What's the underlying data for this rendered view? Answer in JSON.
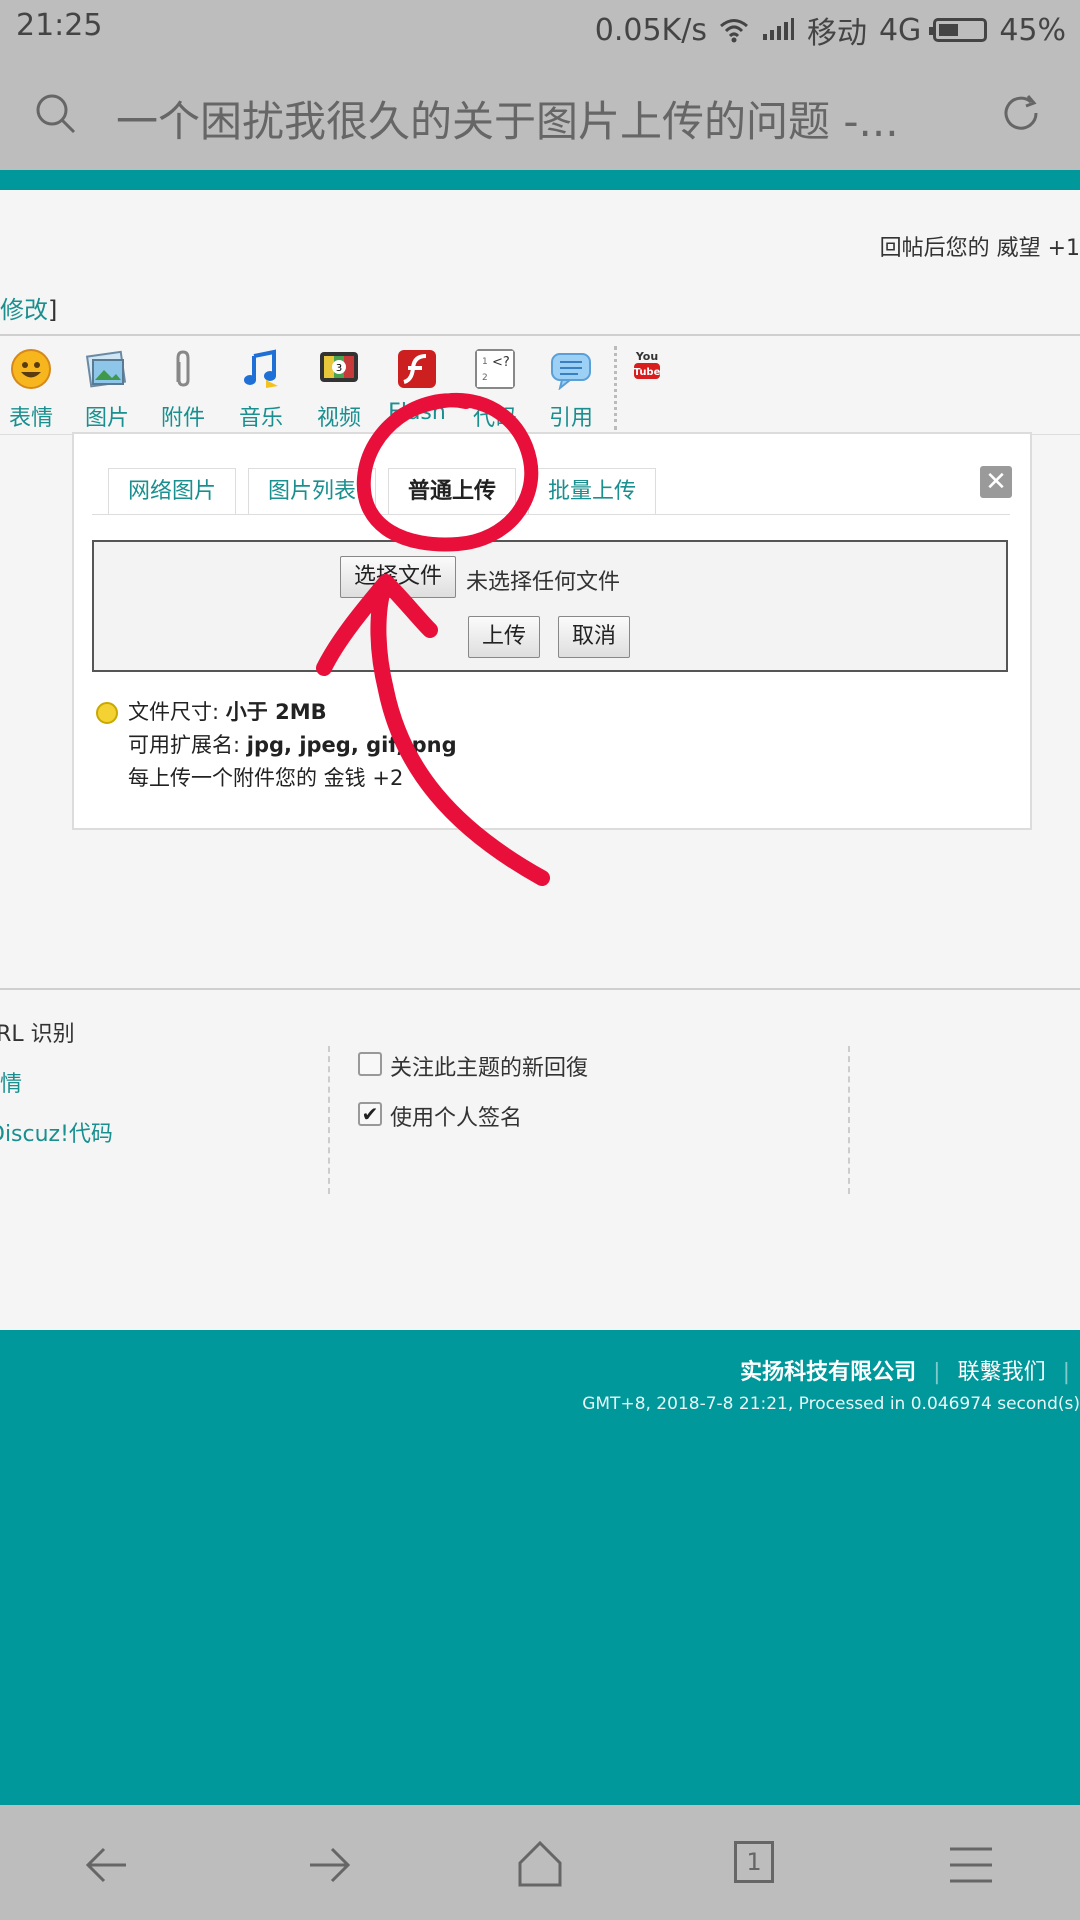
{
  "status_bar": {
    "time": "21:25",
    "speed": "0.05K/s",
    "carrier": "移动",
    "network": "4G",
    "battery": "45%",
    "battery_level": 0.45
  },
  "address_bar": {
    "title": "一个困扰我很久的关于图片上传的问题 -..."
  },
  "page": {
    "reply_prestige": "回帖后您的 威望 +1",
    "edit_fragment_bracket": "]",
    "edit_fragment_link": "修改",
    "toolbar": {
      "items": [
        {
          "label": "表情",
          "icon": "smiley-icon"
        },
        {
          "label": "图片",
          "icon": "image-icon"
        },
        {
          "label": "附件",
          "icon": "paperclip-icon"
        },
        {
          "label": "音乐",
          "icon": "music-note-icon"
        },
        {
          "label": "视频",
          "icon": "video-tv-icon"
        },
        {
          "label": "Flash",
          "icon": "flash-icon"
        },
        {
          "label": "代码",
          "icon": "code-icon"
        },
        {
          "label": "引用",
          "icon": "quote-bubble-icon"
        }
      ],
      "youtube_icon": "youtube-icon"
    },
    "dialog": {
      "tabs": [
        "网络图片",
        "图片列表",
        "普通上传",
        "批量上传"
      ],
      "active_tab": "普通上传",
      "choose_file_button": "选择文件",
      "no_file_text": "未选择任何文件",
      "upload_button": "上传",
      "cancel_button": "取消",
      "size_label": "文件尺寸:",
      "size_value": "小于 2MB",
      "ext_label": "可用扩展名:",
      "ext_value": "jpg, jpeg, gif, png",
      "reward_text": "每上传一个附件您的 金钱 +2"
    },
    "options": {
      "left": [
        "URL 识别",
        "表情",
        "Discuz!代码"
      ],
      "follow_label": "关注此主题的新回復",
      "follow_checked": false,
      "signature_label": "使用个人签名",
      "signature_checked": true
    },
    "footer": {
      "company": "实扬科技有限公司",
      "contact": "联繫我们",
      "stats": "GMT+8, 2018-7-8 21:21, Processed in 0.046974 second(s)"
    }
  },
  "bottom_nav": {
    "items": [
      "back-icon",
      "forward-icon",
      "home-icon",
      "tabs-icon",
      "menu-icon"
    ],
    "tab_count": "1"
  },
  "colors": {
    "accent": "#00989a",
    "annotation": "#e8103a"
  }
}
